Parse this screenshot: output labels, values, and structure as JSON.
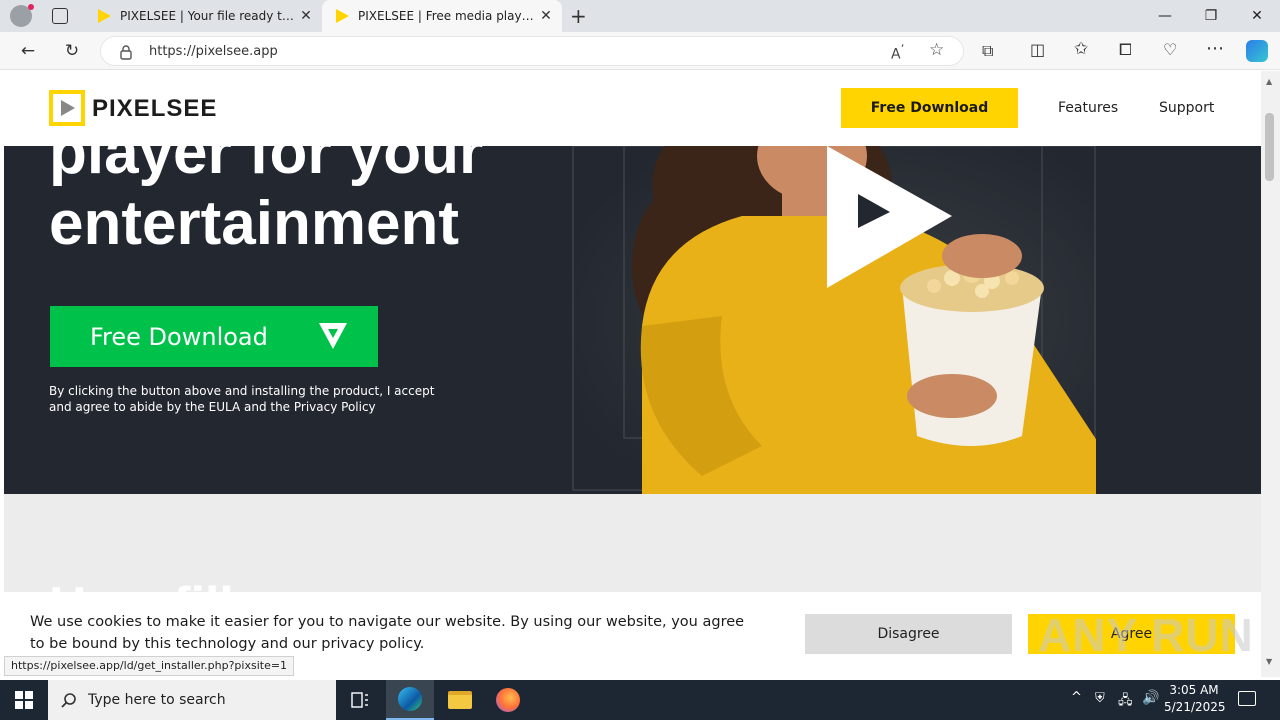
{
  "browser": {
    "tabs": [
      {
        "title": "PIXELSEE | Your file ready to dow"
      },
      {
        "title": "PIXELSEE | Free media player for y"
      }
    ],
    "url": "https://pixelsee.app"
  },
  "site": {
    "brand": "PIXELSEE",
    "header": {
      "download_label": "Free Download",
      "links": [
        "Features",
        "Support"
      ]
    },
    "hero": {
      "title_line1": "player for your",
      "title_line2": "entertainment",
      "download_label": "Free Download",
      "eula_text": "By clicking the button above and installing the product, I accept and agree to abide by the EULA and the Privacy Policy"
    },
    "lower_heading_partial": "How fill"
  },
  "cookie_banner": {
    "text": "We use cookies to make it easier for you to navigate our website. By using our website, you agree to be bound by this technology and our privacy policy.",
    "disagree_label": "Disagree",
    "agree_label": "Agree"
  },
  "status_bar": {
    "url": "https://pixelsee.app/ld/get_installer.php?pixsite=1"
  },
  "taskbar": {
    "search_placeholder": "Type here to search",
    "time": "3:05 AM",
    "date": "5/21/2025"
  },
  "watermark": "ANY RUN",
  "colors": {
    "accent_yellow": "#ffd400",
    "download_green": "#00c24a",
    "hero_bg": "#232830"
  }
}
